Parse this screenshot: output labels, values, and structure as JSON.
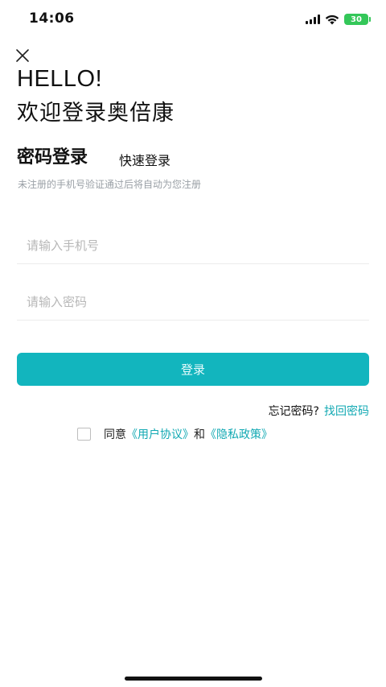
{
  "status_bar": {
    "time": "14:06",
    "battery": "30",
    "icons": [
      "signal-icon",
      "wifi-icon",
      "battery-charging-icon"
    ]
  },
  "close_icon": "close-icon",
  "greeting": {
    "hello": "HELLO!",
    "welcome": "欢迎登录奥倍康"
  },
  "tabs": {
    "password_login": "密码登录",
    "quick_login": "快速登录"
  },
  "hint": "未注册的手机号验证通过后将自动为您注册",
  "inputs": {
    "phone_placeholder": "请输入手机号",
    "phone_value": "",
    "password_placeholder": "请输入密码",
    "password_value": ""
  },
  "login_button": "登录",
  "forgot": {
    "question": "忘记密码?",
    "link": "找回密码"
  },
  "agreement": {
    "checked": false,
    "prefix": "同意",
    "user_agreement": "《用户协议》",
    "and": "和",
    "privacy_policy": "《隐私政策》"
  },
  "colors": {
    "accent": "#12b5be",
    "link": "#12a9b3",
    "battery": "#34c759"
  }
}
